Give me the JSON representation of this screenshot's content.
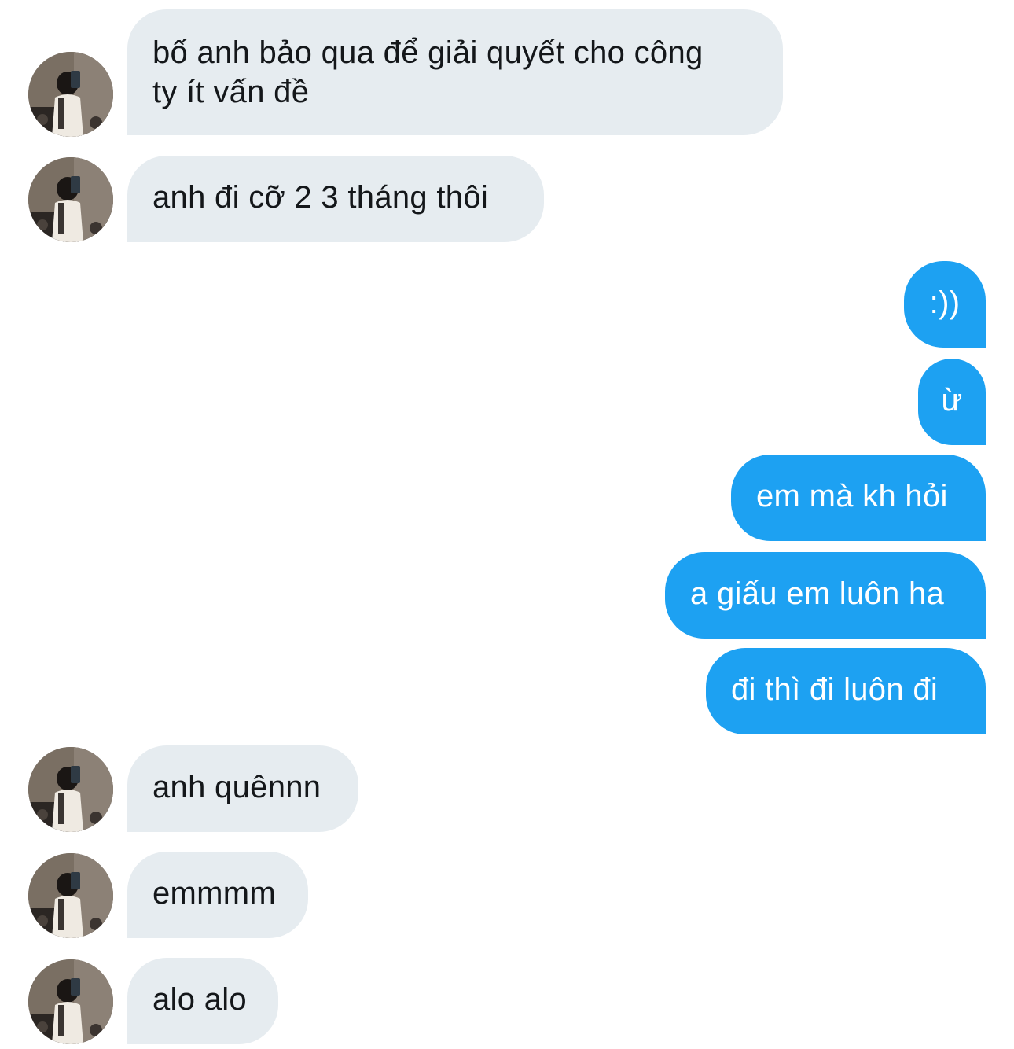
{
  "conversation": {
    "messages": [
      {
        "direction": "incoming",
        "text": "bố anh bảo qua để giải quyết cho công\nty ít vấn đề",
        "has_avatar": true
      },
      {
        "direction": "incoming",
        "text": "anh đi cỡ 2 3 tháng thôi",
        "has_avatar": true
      },
      {
        "direction": "outgoing",
        "text": ":))"
      },
      {
        "direction": "outgoing",
        "text": "ừ"
      },
      {
        "direction": "outgoing",
        "text": "em mà kh hỏi"
      },
      {
        "direction": "outgoing",
        "text": "a giấu em luôn ha"
      },
      {
        "direction": "outgoing",
        "text": "đi thì đi luôn đi"
      },
      {
        "direction": "incoming",
        "text": "anh quênnn",
        "has_avatar": true
      },
      {
        "direction": "incoming",
        "text": "emmmm",
        "has_avatar": true
      },
      {
        "direction": "incoming",
        "text": "alo alo",
        "has_avatar": true
      }
    ]
  },
  "colors": {
    "incoming_bubble": "#e6ecf0",
    "incoming_text": "#14171a",
    "outgoing_bubble": "#1da1f2",
    "outgoing_text": "#ffffff",
    "background": "#ffffff"
  },
  "icons": {
    "avatar": "user-avatar-photo"
  }
}
